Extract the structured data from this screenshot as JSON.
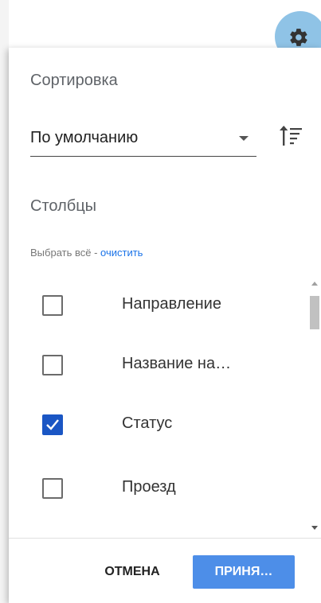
{
  "sort": {
    "title": "Сортировка",
    "selected": "По умолчанию",
    "order_icon": "sort-order-icon"
  },
  "columns": {
    "title": "Столбцы",
    "select_all": "Выбрать всё",
    "separator": " - ",
    "clear": "очистить",
    "items": [
      {
        "label": "Направление",
        "checked": false
      },
      {
        "label": "Название на…",
        "checked": false
      },
      {
        "label": "Статус",
        "checked": true
      },
      {
        "label": "Проезд",
        "checked": false
      }
    ]
  },
  "footer": {
    "cancel": "ОТМЕНА",
    "apply": "ПРИНЯ…"
  },
  "colors": {
    "accent": "#4d8ee8",
    "checkbox_checked": "#1a56c4",
    "link": "#1a73e8",
    "gear_bg": "#8fc3e6"
  }
}
